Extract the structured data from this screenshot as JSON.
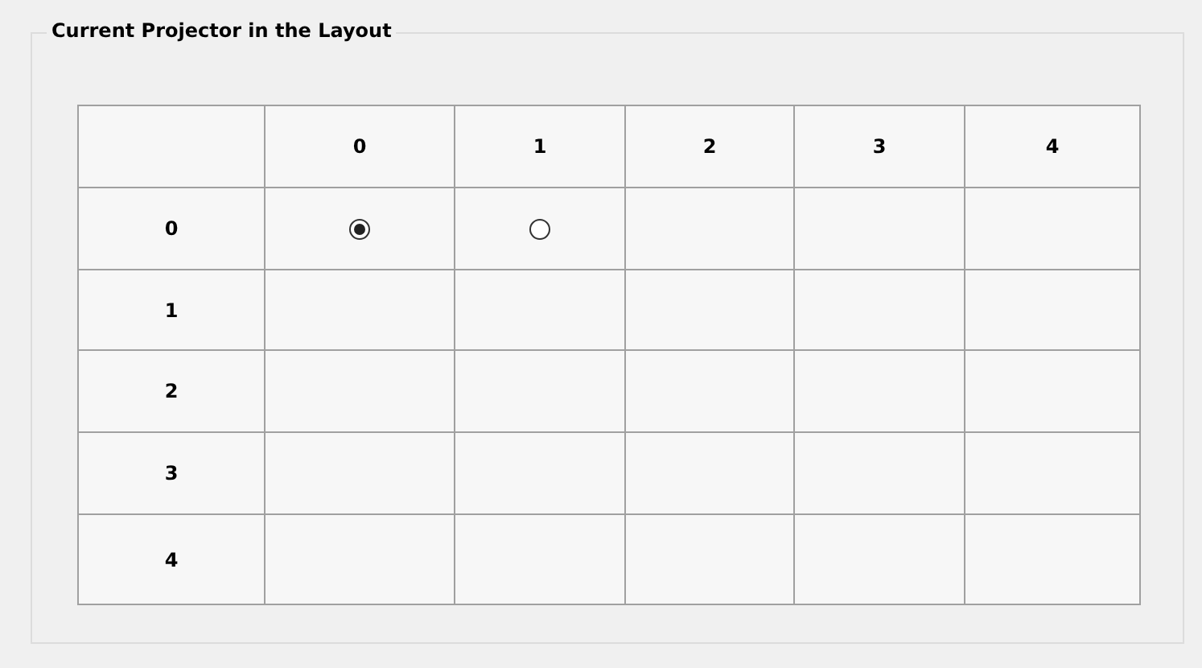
{
  "group": {
    "title": "Current Projector in the Layout"
  },
  "table": {
    "columns": [
      "0",
      "1",
      "2",
      "3",
      "4"
    ],
    "rows": [
      {
        "label": "0",
        "cells": [
          {
            "kind": "radio",
            "selected": true
          },
          {
            "kind": "radio",
            "selected": false
          },
          {
            "kind": "empty"
          },
          {
            "kind": "empty"
          },
          {
            "kind": "empty"
          }
        ]
      },
      {
        "label": "1",
        "cells": [
          {
            "kind": "empty"
          },
          {
            "kind": "empty"
          },
          {
            "kind": "empty"
          },
          {
            "kind": "empty"
          },
          {
            "kind": "empty"
          }
        ]
      },
      {
        "label": "2",
        "cells": [
          {
            "kind": "empty"
          },
          {
            "kind": "empty"
          },
          {
            "kind": "empty"
          },
          {
            "kind": "empty"
          },
          {
            "kind": "empty"
          }
        ]
      },
      {
        "label": "3",
        "cells": [
          {
            "kind": "empty"
          },
          {
            "kind": "empty"
          },
          {
            "kind": "empty"
          },
          {
            "kind": "empty"
          },
          {
            "kind": "empty"
          }
        ]
      },
      {
        "label": "4",
        "cells": [
          {
            "kind": "empty"
          },
          {
            "kind": "empty"
          },
          {
            "kind": "empty"
          },
          {
            "kind": "empty"
          },
          {
            "kind": "empty"
          }
        ]
      }
    ]
  }
}
